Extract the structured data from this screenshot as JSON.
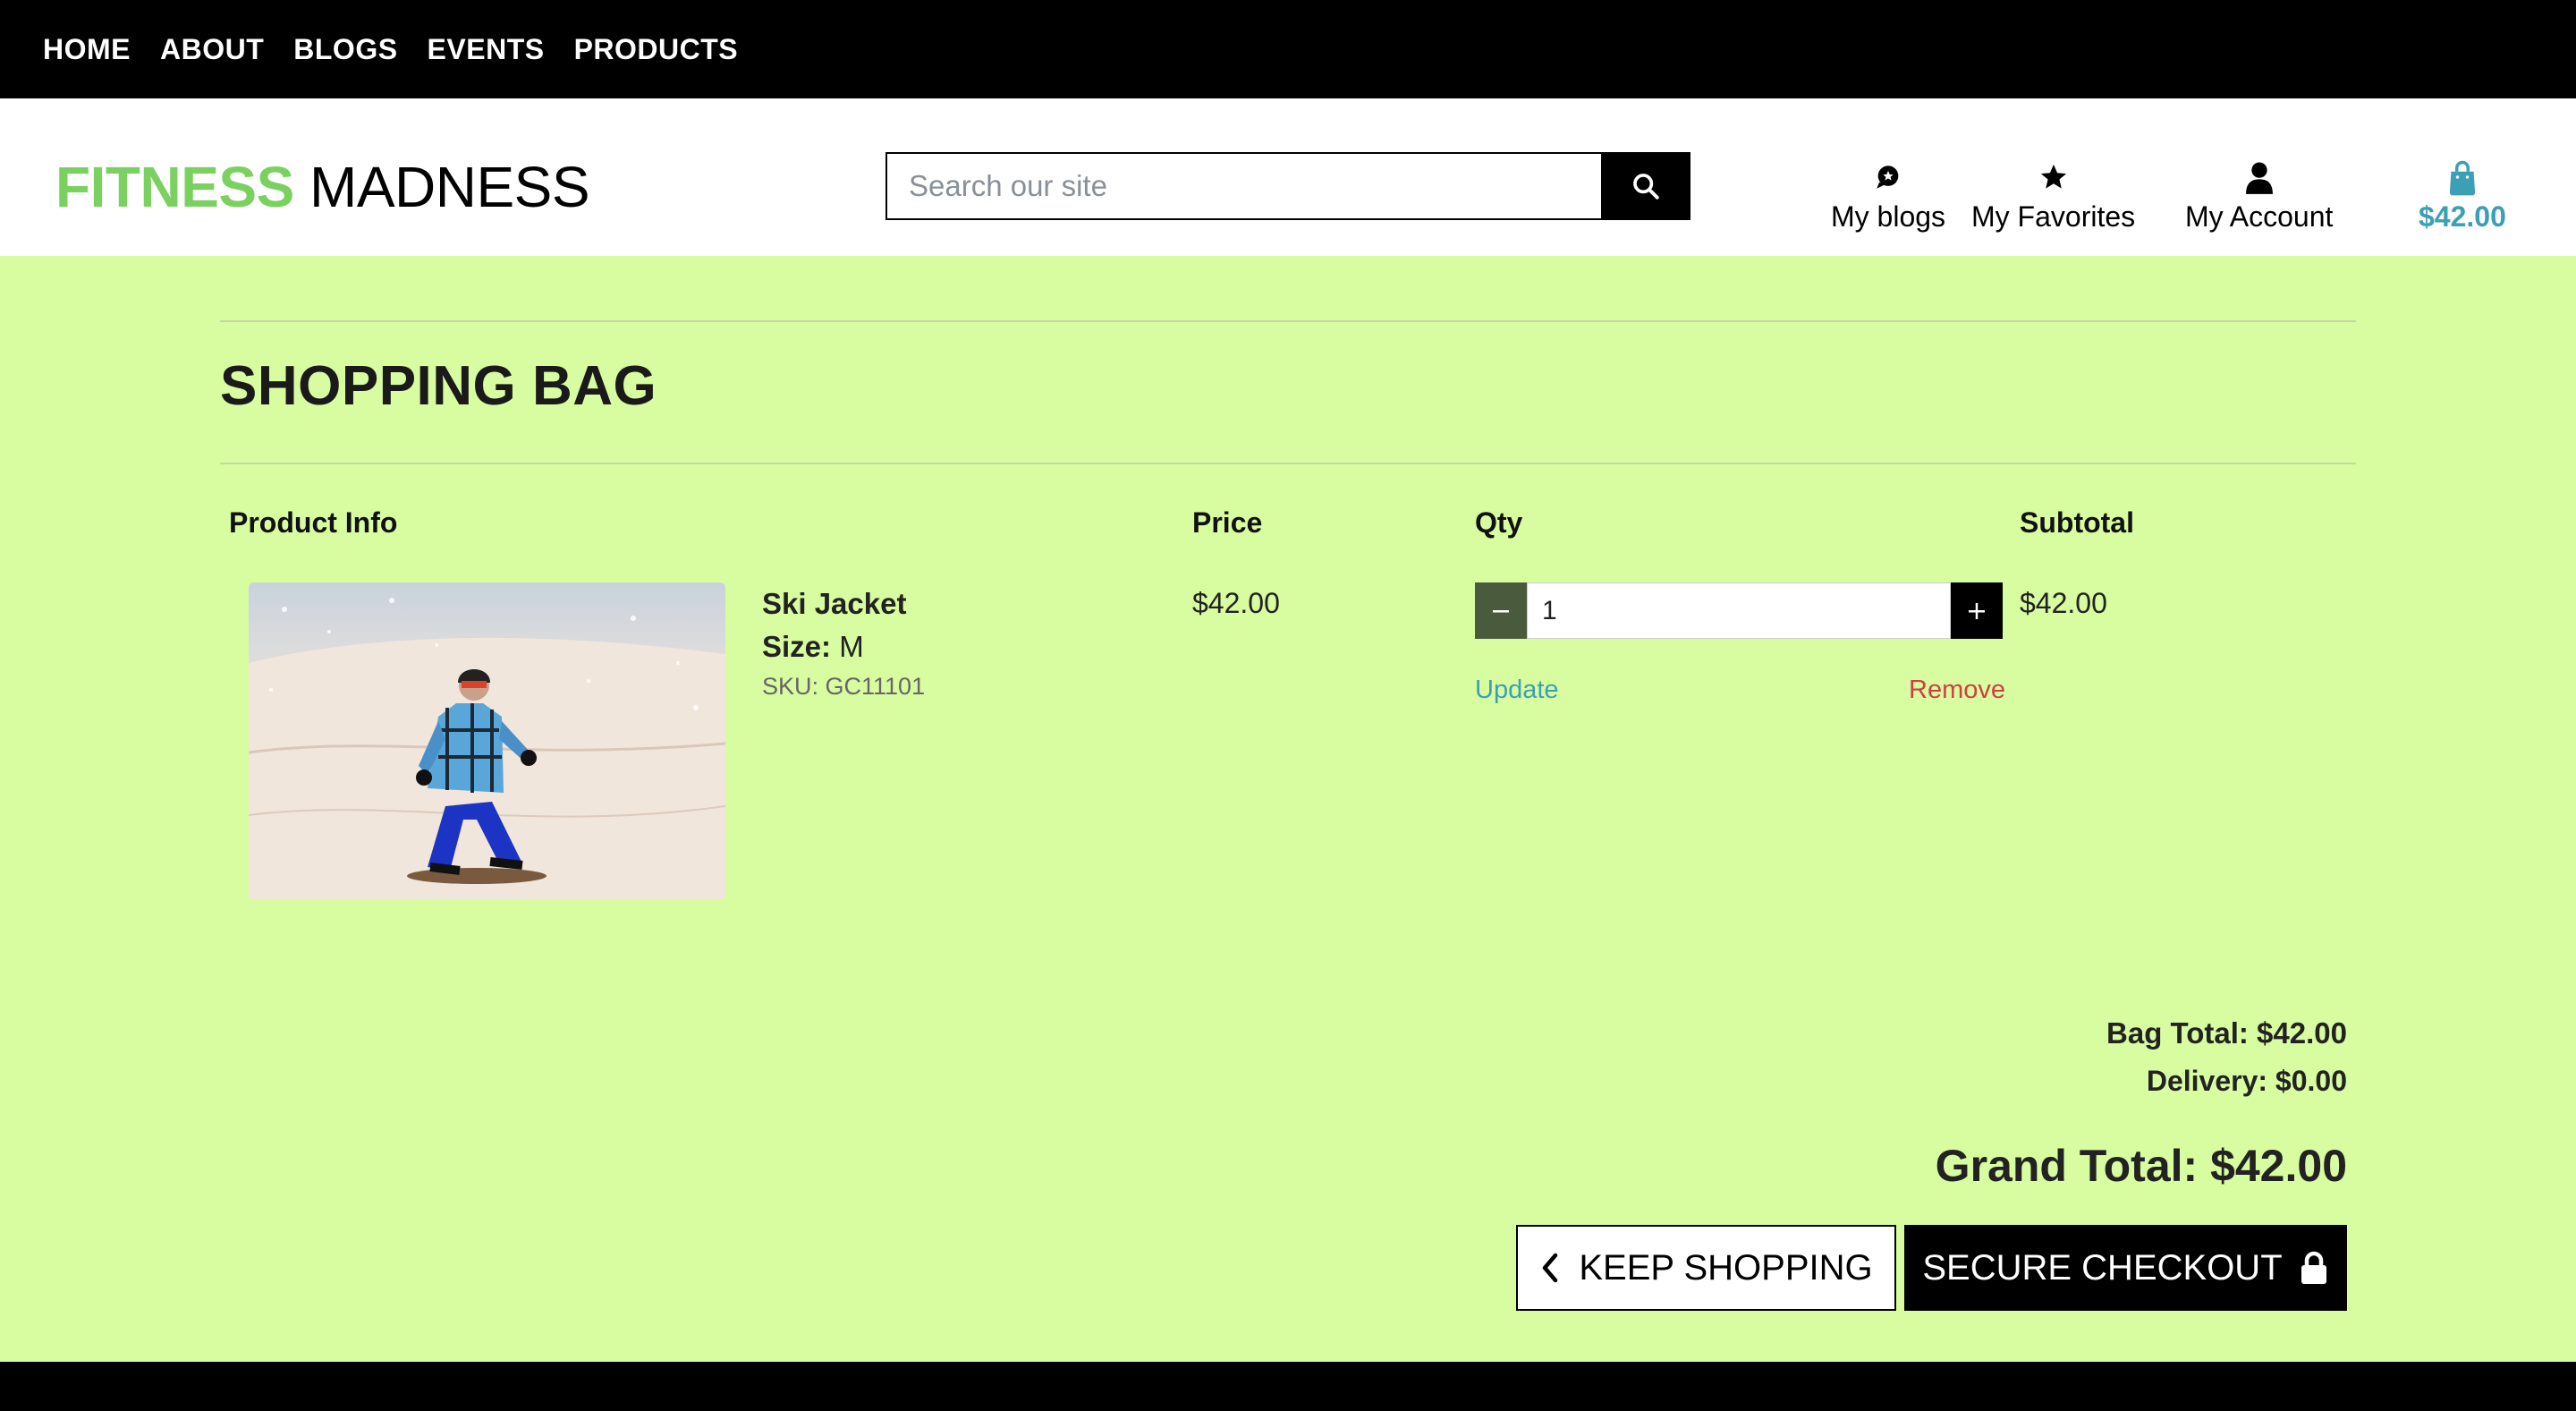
{
  "topnav": {
    "items": [
      "HOME",
      "ABOUT",
      "BLOGS",
      "EVENTS",
      "PRODUCTS"
    ]
  },
  "header": {
    "logo_part1": "FITNESS",
    "logo_part2": "MADNESS",
    "search_placeholder": "Search our site",
    "links": {
      "blogs": "My blogs",
      "favorites": "My Favorites",
      "account": "My Account",
      "bag_total": "$42.00"
    }
  },
  "page": {
    "title": "SHOPPING BAG"
  },
  "table": {
    "headers": [
      "Product Info",
      "Price",
      "Qty",
      "Subtotal"
    ],
    "rows": [
      {
        "name": "Ski Jacket",
        "size_label": "Size:",
        "size": "M",
        "sku": "SKU: GC11101",
        "price": "$42.00",
        "qty": "1",
        "subtotal": "$42.00",
        "update_label": "Update",
        "remove_label": "Remove"
      }
    ]
  },
  "totals": {
    "bag_total": "Bag Total: $42.00",
    "delivery": "Delivery: $0.00",
    "grand_total": "Grand Total: $42.00"
  },
  "actions": {
    "keep_shopping": "KEEP SHOPPING",
    "secure_checkout": "SECURE CHECKOUT"
  },
  "colors": {
    "page_bg": "#d8fca0",
    "brand_green": "#7bd160",
    "link_blue": "#3d9fb5",
    "remove_red": "#d04040"
  }
}
